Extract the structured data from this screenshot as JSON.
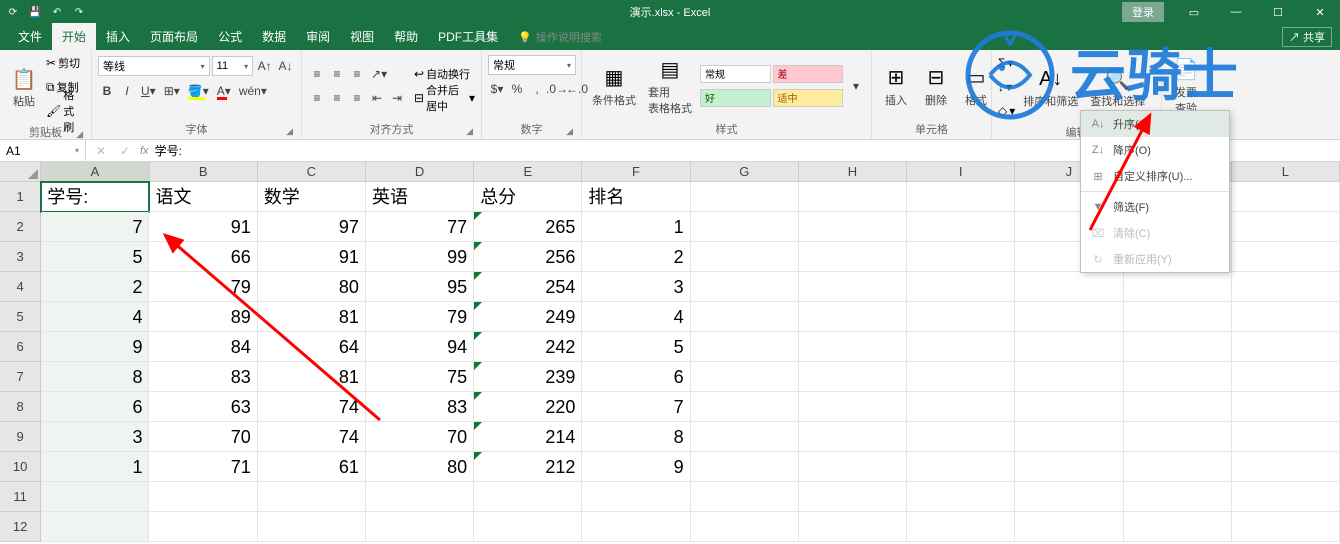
{
  "title": "演示.xlsx - Excel",
  "login": "登录",
  "share": "共享",
  "tabs": [
    "文件",
    "开始",
    "插入",
    "页面布局",
    "公式",
    "数据",
    "审阅",
    "视图",
    "帮助",
    "PDF工具集"
  ],
  "tellme": "操作说明搜索",
  "clipboard": {
    "label": "剪贴板",
    "paste": "粘贴",
    "cut": "剪切",
    "copy": "复制",
    "painter": "格式刷"
  },
  "font": {
    "label": "字体",
    "name": "等线",
    "size": "11"
  },
  "align": {
    "label": "对齐方式",
    "wrap": "自动换行",
    "merge": "合并后居中"
  },
  "number": {
    "label": "数字",
    "format": "常规"
  },
  "styles": {
    "label": "样式",
    "cond": "条件格式",
    "table": "套用\n表格格式",
    "normal": "常规",
    "bad": "差",
    "good": "好",
    "neutral": "适中"
  },
  "cells": {
    "label": "单元格",
    "insert": "插入",
    "delete": "删除",
    "format": "格式"
  },
  "editing": {
    "label": "编辑",
    "sort": "排序和筛选",
    "find": "查找和选择",
    "clear": "清除"
  },
  "invoice": {
    "label": "发票查验",
    "btn": "发票\n查验"
  },
  "dropdown": {
    "asc": "升序(S)",
    "desc": "降序(O)",
    "custom": "自定义排序(U)...",
    "filter": "筛选(F)",
    "clear": "清除(C)",
    "reapply": "重新应用(Y)"
  },
  "namebox": "A1",
  "formula": "学号:",
  "cols": [
    "A",
    "B",
    "C",
    "D",
    "E",
    "F",
    "G",
    "H",
    "I",
    "J",
    "K",
    "L"
  ],
  "headers": [
    "学号:",
    "语文",
    "数学",
    "英语",
    "总分",
    "排名"
  ],
  "data": [
    [
      7,
      91,
      97,
      77,
      265,
      1
    ],
    [
      5,
      66,
      91,
      99,
      256,
      2
    ],
    [
      2,
      79,
      80,
      95,
      254,
      3
    ],
    [
      4,
      89,
      81,
      79,
      249,
      4
    ],
    [
      9,
      84,
      64,
      94,
      242,
      5
    ],
    [
      8,
      83,
      81,
      75,
      239,
      6
    ],
    [
      6,
      63,
      74,
      83,
      220,
      7
    ],
    [
      3,
      70,
      74,
      70,
      214,
      8
    ],
    [
      1,
      71,
      61,
      80,
      212,
      9
    ]
  ],
  "watermark": "云骑士"
}
